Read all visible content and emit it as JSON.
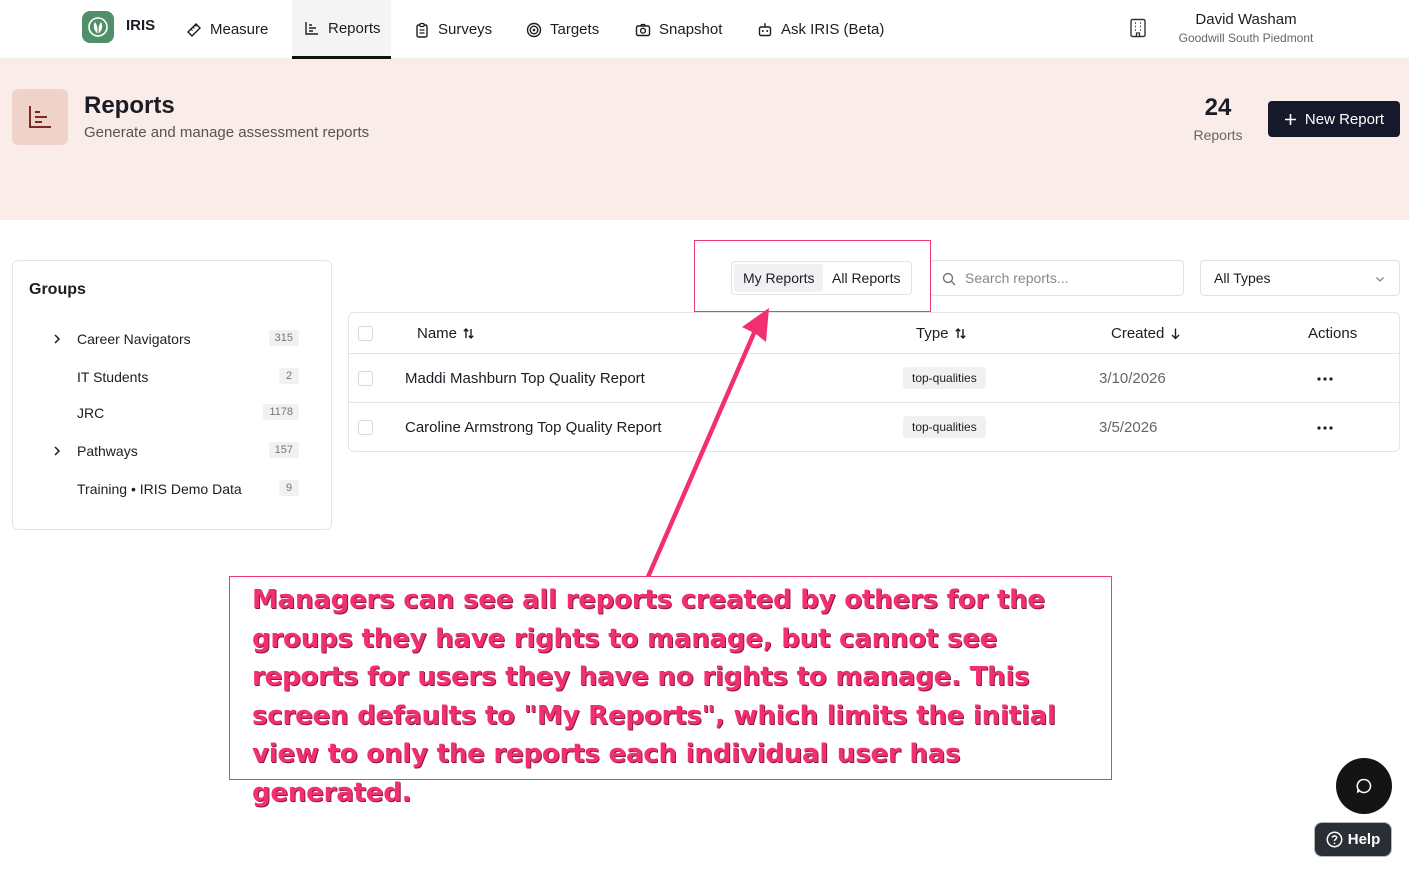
{
  "nav": {
    "brand": "IRIS",
    "items": [
      {
        "label": "Measure",
        "icon": "ruler-icon"
      },
      {
        "label": "Reports",
        "icon": "chart-icon",
        "active": true
      },
      {
        "label": "Surveys",
        "icon": "clipboard-icon"
      },
      {
        "label": "Targets",
        "icon": "target-icon"
      },
      {
        "label": "Snapshot",
        "icon": "camera-icon"
      },
      {
        "label": "Ask IRIS (Beta)",
        "icon": "robot-icon"
      }
    ],
    "user_name": "David Washam",
    "user_org": "Goodwill South Piedmont"
  },
  "hero": {
    "title": "Reports",
    "subtitle": "Generate and manage assessment reports",
    "stat_value": "24",
    "stat_label": "Reports",
    "new_button": "New Report"
  },
  "groups": {
    "title": "Groups",
    "items": [
      {
        "label": "Career Navigators",
        "count": "315",
        "expandable": true
      },
      {
        "label": "IT Students",
        "count": "2",
        "expandable": false
      },
      {
        "label": "JRC",
        "count": "1178",
        "expandable": false
      },
      {
        "label": "Pathways",
        "count": "157",
        "expandable": true
      },
      {
        "label": "Training • IRIS Demo Data",
        "count": "9",
        "expandable": false
      }
    ]
  },
  "filters": {
    "my_reports": "My Reports",
    "all_reports": "All Reports",
    "search_placeholder": "Search reports...",
    "type_select": "All Types"
  },
  "table": {
    "columns": {
      "name": "Name",
      "type": "Type",
      "created": "Created",
      "actions": "Actions"
    },
    "rows": [
      {
        "name": "Maddi Mashburn Top Quality Report",
        "type": "top-qualities",
        "created": "3/10/2026"
      },
      {
        "name": "Caroline Armstrong Top Quality Report",
        "type": "top-qualities",
        "created": "3/5/2026"
      }
    ]
  },
  "annotation": {
    "text": "Managers can see all reports created by others for the groups they have rights to manage, but cannot see reports for users they have no rights to manage. This screen defaults to \"My Reports\", which limits the initial view to only the reports each individual user has generated.",
    "color": "#f2306f"
  },
  "help": {
    "label": "Help"
  },
  "colors": {
    "accent": "#15192b",
    "hero_bg": "#f9ece9",
    "logo": "#4f8f69",
    "highlight": "#ea3d79"
  }
}
